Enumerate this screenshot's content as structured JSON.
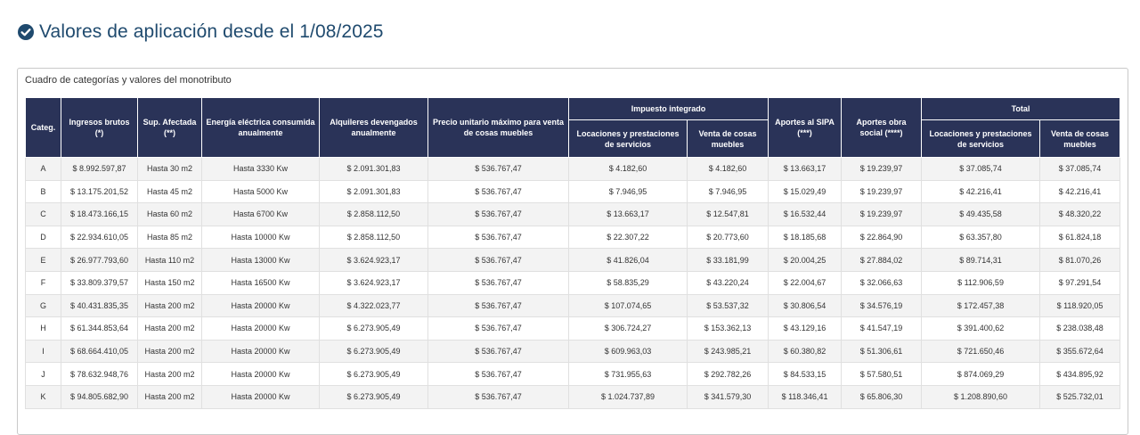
{
  "header": {
    "title": "Valores de aplicación desde el 1/08/2025",
    "icon": "check-circle-icon",
    "accent_color": "#1f4a6e"
  },
  "panel": {
    "caption": "Cuadro de categorías y valores del monotributo"
  },
  "table": {
    "header_bg": "#2a3358",
    "group_headers": {
      "impuesto": "Impuesto integrado",
      "total": "Total"
    },
    "columns": {
      "categ": "Categ.",
      "ingresos": "Ingresos brutos (*)",
      "sup": "Sup. Afectada (**)",
      "energia": "Energía eléctrica consumida anualmente",
      "alquileres": "Alquileres devengados anualmente",
      "precio": "Precio unitario máximo para venta de cosas muebles",
      "imp_locaciones": "Locaciones y prestaciones de servicios",
      "imp_venta": "Venta de cosas muebles",
      "sipa": "Aportes al SIPA (***)",
      "obra": "Aportes obra social (****)",
      "tot_locaciones": "Locaciones y prestaciones de servicios",
      "tot_venta": "Venta de cosas muebles"
    },
    "rows": [
      {
        "categ": "A",
        "ingresos": "$ 8.992.597,87",
        "sup": "Hasta 30 m2",
        "energia": "Hasta 3330 Kw",
        "alquileres": "$ 2.091.301,83",
        "precio": "$ 536.767,47",
        "imp_locaciones": "$ 4.182,60",
        "imp_venta": "$ 4.182,60",
        "sipa": "$ 13.663,17",
        "obra": "$ 19.239,97",
        "tot_locaciones": "$ 37.085,74",
        "tot_venta": "$ 37.085,74"
      },
      {
        "categ": "B",
        "ingresos": "$ 13.175.201,52",
        "sup": "Hasta 45 m2",
        "energia": "Hasta 5000 Kw",
        "alquileres": "$ 2.091.301,83",
        "precio": "$ 536.767,47",
        "imp_locaciones": "$ 7.946,95",
        "imp_venta": "$ 7.946,95",
        "sipa": "$ 15.029,49",
        "obra": "$ 19.239,97",
        "tot_locaciones": "$ 42.216,41",
        "tot_venta": "$ 42.216,41"
      },
      {
        "categ": "C",
        "ingresos": "$ 18.473.166,15",
        "sup": "Hasta 60 m2",
        "energia": "Hasta 6700 Kw",
        "alquileres": "$ 2.858.112,50",
        "precio": "$ 536.767,47",
        "imp_locaciones": "$ 13.663,17",
        "imp_venta": "$ 12.547,81",
        "sipa": "$ 16.532,44",
        "obra": "$ 19.239,97",
        "tot_locaciones": "$ 49.435,58",
        "tot_venta": "$ 48.320,22"
      },
      {
        "categ": "D",
        "ingresos": "$ 22.934.610,05",
        "sup": "Hasta 85 m2",
        "energia": "Hasta 10000 Kw",
        "alquileres": "$ 2.858.112,50",
        "precio": "$ 536.767,47",
        "imp_locaciones": "$ 22.307,22",
        "imp_venta": "$ 20.773,60",
        "sipa": "$ 18.185,68",
        "obra": "$ 22.864,90",
        "tot_locaciones": "$ 63.357,80",
        "tot_venta": "$ 61.824,18"
      },
      {
        "categ": "E",
        "ingresos": "$ 26.977.793,60",
        "sup": "Hasta 110 m2",
        "energia": "Hasta 13000 Kw",
        "alquileres": "$ 3.624.923,17",
        "precio": "$ 536.767,47",
        "imp_locaciones": "$ 41.826,04",
        "imp_venta": "$ 33.181,99",
        "sipa": "$ 20.004,25",
        "obra": "$ 27.884,02",
        "tot_locaciones": "$ 89.714,31",
        "tot_venta": "$ 81.070,26"
      },
      {
        "categ": "F",
        "ingresos": "$ 33.809.379,57",
        "sup": "Hasta 150 m2",
        "energia": "Hasta 16500 Kw",
        "alquileres": "$ 3.624.923,17",
        "precio": "$ 536.767,47",
        "imp_locaciones": "$ 58.835,29",
        "imp_venta": "$ 43.220,24",
        "sipa": "$ 22.004,67",
        "obra": "$ 32.066,63",
        "tot_locaciones": "$ 112.906,59",
        "tot_venta": "$ 97.291,54"
      },
      {
        "categ": "G",
        "ingresos": "$ 40.431.835,35",
        "sup": "Hasta 200 m2",
        "energia": "Hasta 20000 Kw",
        "alquileres": "$ 4.322.023,77",
        "precio": "$ 536.767,47",
        "imp_locaciones": "$ 107.074,65",
        "imp_venta": "$ 53.537,32",
        "sipa": "$ 30.806,54",
        "obra": "$ 34.576,19",
        "tot_locaciones": "$ 172.457,38",
        "tot_venta": "$ 118.920,05"
      },
      {
        "categ": "H",
        "ingresos": "$ 61.344.853,64",
        "sup": "Hasta 200 m2",
        "energia": "Hasta 20000 Kw",
        "alquileres": "$ 6.273.905,49",
        "precio": "$ 536.767,47",
        "imp_locaciones": "$ 306.724,27",
        "imp_venta": "$ 153.362,13",
        "sipa": "$ 43.129,16",
        "obra": "$ 41.547,19",
        "tot_locaciones": "$ 391.400,62",
        "tot_venta": "$ 238.038,48"
      },
      {
        "categ": "I",
        "ingresos": "$ 68.664.410,05",
        "sup": "Hasta 200 m2",
        "energia": "Hasta 20000 Kw",
        "alquileres": "$ 6.273.905,49",
        "precio": "$ 536.767,47",
        "imp_locaciones": "$ 609.963,03",
        "imp_venta": "$ 243.985,21",
        "sipa": "$ 60.380,82",
        "obra": "$ 51.306,61",
        "tot_locaciones": "$ 721.650,46",
        "tot_venta": "$ 355.672,64"
      },
      {
        "categ": "J",
        "ingresos": "$ 78.632.948,76",
        "sup": "Hasta 200 m2",
        "energia": "Hasta 20000 Kw",
        "alquileres": "$ 6.273.905,49",
        "precio": "$ 536.767,47",
        "imp_locaciones": "$ 731.955,63",
        "imp_venta": "$ 292.782,26",
        "sipa": "$ 84.533,15",
        "obra": "$ 57.580,51",
        "tot_locaciones": "$ 874.069,29",
        "tot_venta": "$ 434.895,92"
      },
      {
        "categ": "K",
        "ingresos": "$ 94.805.682,90",
        "sup": "Hasta 200 m2",
        "energia": "Hasta 20000 Kw",
        "alquileres": "$ 6.273.905,49",
        "precio": "$ 536.767,47",
        "imp_locaciones": "$ 1.024.737,89",
        "imp_venta": "$ 341.579,30",
        "sipa": "$ 118.346,41",
        "obra": "$ 65.806,30",
        "tot_locaciones": "$ 1.208.890,60",
        "tot_venta": "$ 525.732,01"
      }
    ]
  }
}
